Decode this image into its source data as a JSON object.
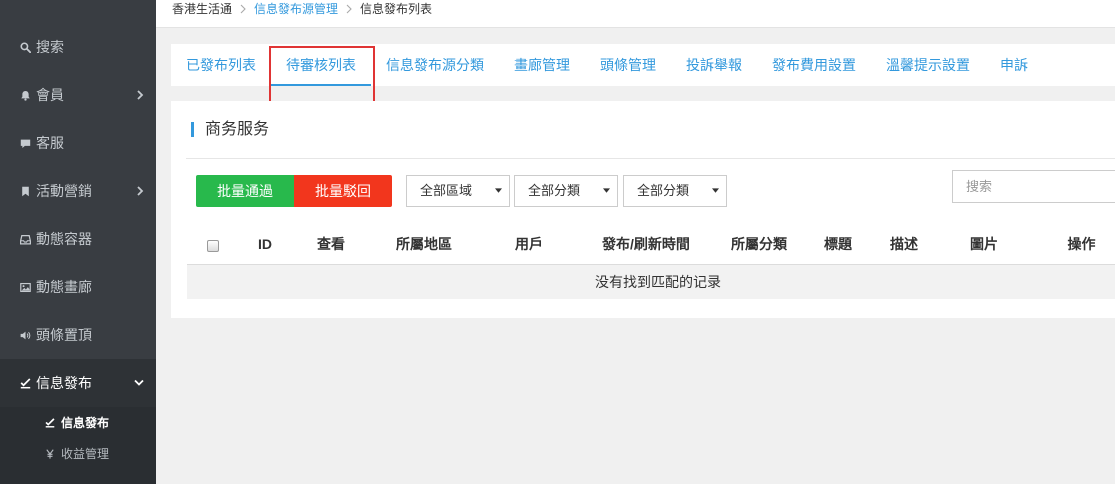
{
  "breadcrumb": {
    "items": [
      "香港生活通",
      "信息發布源管理",
      "信息發布列表"
    ]
  },
  "sidebar": {
    "items": [
      {
        "label": "搜索",
        "icon": "search-icon"
      },
      {
        "label": "會員",
        "icon": "bell-icon",
        "arrow": "chevron-right-icon"
      },
      {
        "label": "客服",
        "icon": "comment-icon"
      },
      {
        "label": "活動營銷",
        "icon": "bookmark-icon",
        "arrow": "chevron-right-icon"
      },
      {
        "label": "動態容器",
        "icon": "inbox-icon"
      },
      {
        "label": "動態畫廊",
        "icon": "picture-icon"
      },
      {
        "label": "頭條置頂",
        "icon": "volume-icon"
      }
    ],
    "active_group": {
      "label": "信息發布",
      "icon": "check-edit-icon",
      "arrow": "chevron-down-icon",
      "children": [
        {
          "label": "信息發布",
          "icon": "check-edit-icon",
          "active": true
        },
        {
          "label": "收益管理",
          "icon": "yen-icon",
          "active": false
        }
      ]
    }
  },
  "tabs": {
    "items": [
      "已發布列表",
      "待審核列表",
      "信息發布源分類",
      "畫廊管理",
      "頭條管理",
      "投訴舉報",
      "發布費用設置",
      "溫馨提示設置",
      "申訴"
    ],
    "active_index": 1
  },
  "panel": {
    "title": "商务服务"
  },
  "toolbar": {
    "approve_label": "批量通過",
    "reject_label": "批量駁回",
    "filters": [
      {
        "selected": "全部區域"
      },
      {
        "selected": "全部分類"
      },
      {
        "selected": "全部分類"
      }
    ],
    "search_placeholder": "搜索"
  },
  "table": {
    "columns": [
      "ID",
      "查看",
      "所屬地區",
      "用戶",
      "發布/刷新時間",
      "所屬分類",
      "標題",
      "描述",
      "圖片",
      "操作"
    ],
    "rows": [],
    "empty_message": "没有找到匹配的记录"
  },
  "colors": {
    "sidebar_bg": "#393d42",
    "sidebar_active_bg": "#2e3236",
    "sidebar_sub_bg": "#2a2e32",
    "accent_blue": "#3399dd",
    "approve_green": "#28b94c",
    "reject_red": "#f2361d",
    "annotation_red": "#e03434"
  }
}
